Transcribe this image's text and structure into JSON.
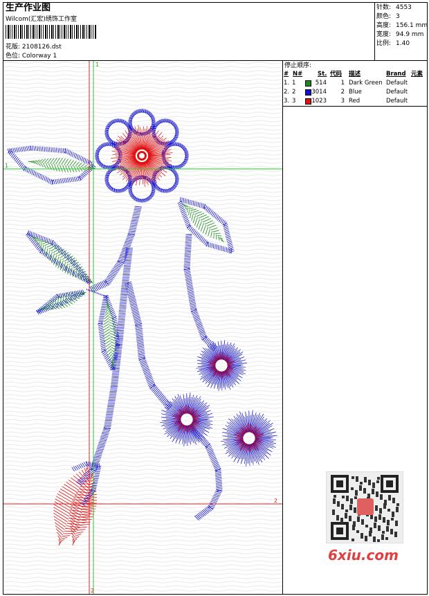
{
  "header": {
    "title": "生产作业图",
    "subtitle": "Wilcom(汇宏)绣饰工作室",
    "design_label": "花版: 2108126.dst",
    "colorway_label": "色位: Colorway 1"
  },
  "stats": [
    {
      "label": "针数:",
      "value": "4553"
    },
    {
      "label": "颜色:",
      "value": "3"
    },
    {
      "label": "高度:",
      "value": "156.1 mm"
    },
    {
      "label": "宽度:",
      "value": "94.9 mm"
    },
    {
      "label": "比例:",
      "value": "1.40"
    }
  ],
  "stop_sequence": {
    "title": "停止顺序:",
    "columns": [
      "#",
      "N#",
      "St.",
      "代码",
      "描述",
      "Brand",
      "元素"
    ],
    "rows": [
      {
        "num": "1.",
        "n": "1",
        "color": "#1a8a1a",
        "st": "514",
        "code": "1",
        "desc": "Dark Green",
        "brand": "Default"
      },
      {
        "num": "2.",
        "n": "2",
        "color": "#1010d0",
        "st": "3014",
        "code": "2",
        "desc": "Blue",
        "brand": "Default"
      },
      {
        "num": "3.",
        "n": "3",
        "color": "#e01010",
        "st": "1023",
        "code": "3",
        "desc": "Red",
        "brand": "Default"
      }
    ]
  },
  "guides": {
    "h1": "1",
    "h2": "2",
    "v1": "1",
    "v2": "2"
  },
  "watermark": {
    "text": "6xiu.com"
  },
  "colors": {
    "green": "#1a8a1a",
    "blue": "#1010d0",
    "red": "#e01010",
    "guide_green": "#22cc22",
    "guide_red": "#e02020"
  }
}
